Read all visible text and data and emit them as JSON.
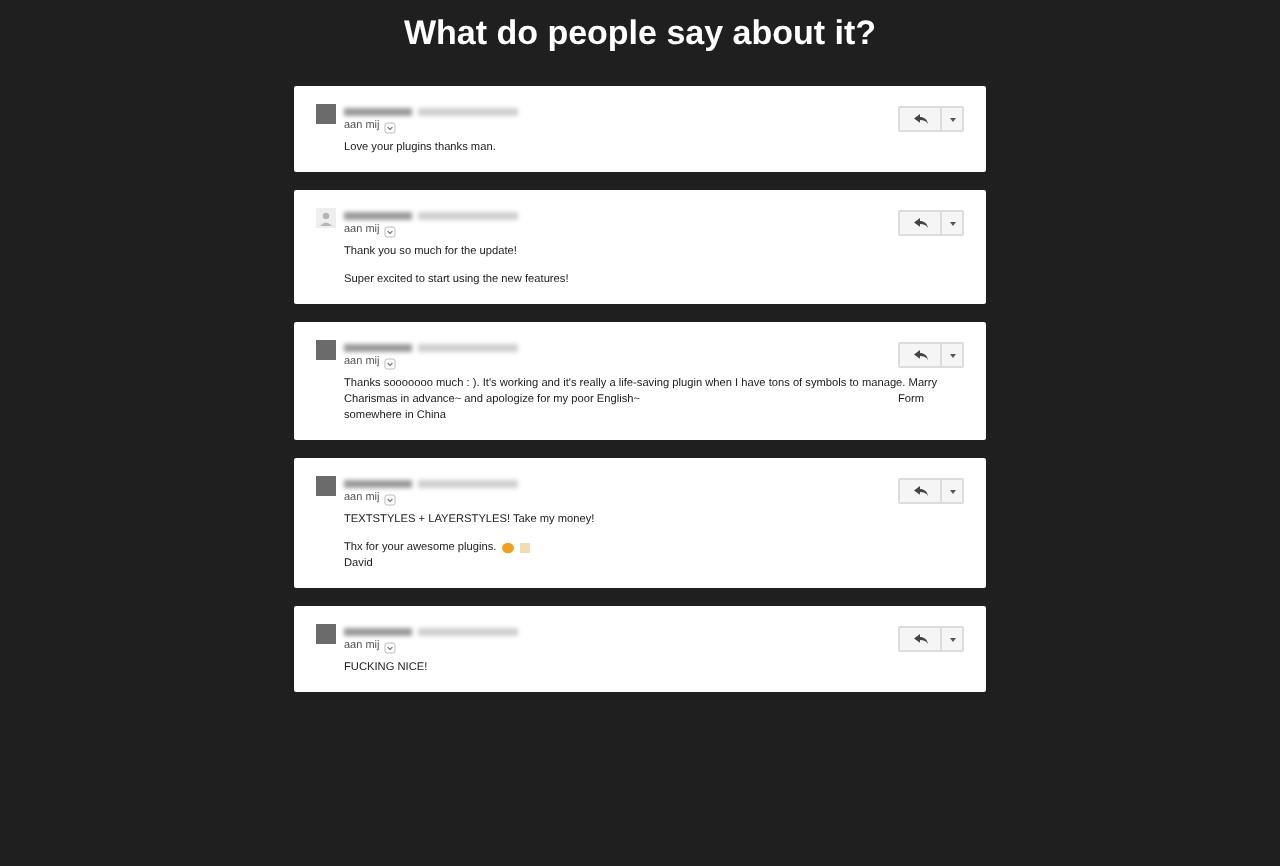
{
  "heading": "What do people say about it?",
  "emails": [
    {
      "avatar": {
        "kind": "photo"
      },
      "recipient": "aan mij",
      "paragraphs": [
        {
          "lines": [
            {
              "text": "Love your plugins thanks man."
            }
          ]
        }
      ]
    },
    {
      "avatar": {
        "kind": "silhouette"
      },
      "recipient": "aan mij",
      "paragraphs": [
        {
          "lines": [
            {
              "text": "Thank you so much for the update!"
            }
          ]
        },
        {
          "lines": [
            {
              "text": "Super excited to start using the new features!"
            }
          ]
        }
      ]
    },
    {
      "avatar": {
        "kind": "photo"
      },
      "recipient": "aan mij",
      "paragraphs": [
        {
          "lines": [
            {
              "text": "Thanks sooooooo much : ). It's working and it's really a life-saving plugin when I have tons of symbols to manage. Marry"
            },
            {
              "text": "Charismas in advance~ and apologize for my poor English~",
              "right": "Form"
            },
            {
              "text": "somewhere in China"
            }
          ]
        }
      ]
    },
    {
      "avatar": {
        "kind": "photo"
      },
      "recipient": "aan mij",
      "paragraphs": [
        {
          "lines": [
            {
              "text": "TEXTSTYLES + LAYERSTYLES! Take my money!"
            }
          ]
        },
        {
          "lines": [
            {
              "text": "Thx for your awesome plugins.",
              "emoji": true
            },
            {
              "text": "David"
            }
          ]
        }
      ]
    },
    {
      "avatar": {
        "kind": "photo"
      },
      "recipient": "aan mij",
      "paragraphs": [
        {
          "lines": [
            {
              "text": "FUCKING NICE!"
            }
          ]
        }
      ]
    }
  ]
}
